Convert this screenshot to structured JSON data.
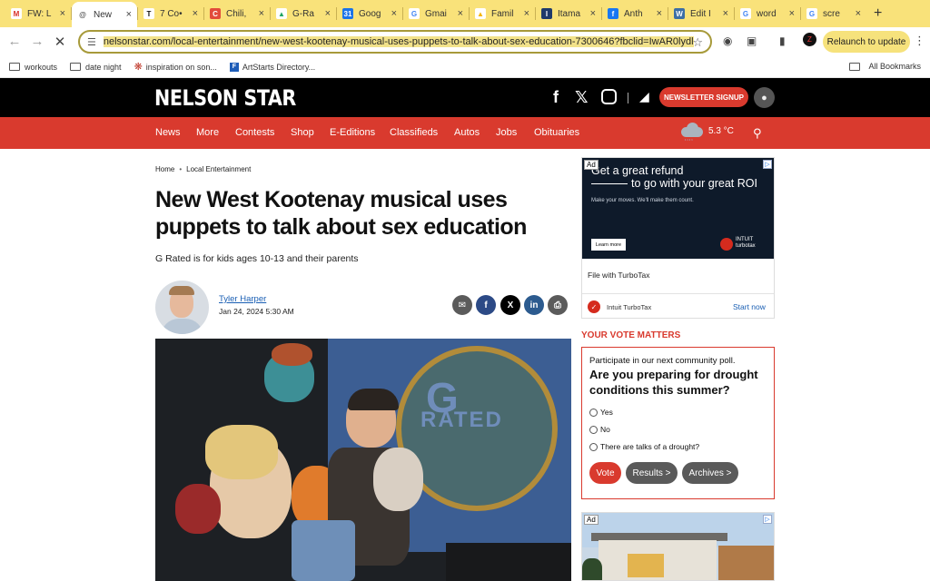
{
  "browser": {
    "tabs": [
      {
        "title": "FW: L",
        "fav_color": "#ffffff",
        "fav_text": "M",
        "fav_text_color": "#d93025"
      },
      {
        "title": "New",
        "fav_color": "#ffffff",
        "fav_text": "@",
        "fav_text_color": "#555555",
        "active": true
      },
      {
        "title": "7 Co•",
        "fav_color": "#ffffff",
        "fav_text": "T",
        "fav_text_color": "#111111"
      },
      {
        "title": "Chili,",
        "fav_color": "#e24b3b",
        "fav_text": "C",
        "fav_text_color": "#ffffff"
      },
      {
        "title": "G-Ra",
        "fav_color": "#ffffff",
        "fav_text": "▲",
        "fav_text_color": "#1fa463"
      },
      {
        "title": "Goog",
        "fav_color": "#1a73e8",
        "fav_text": "31",
        "fav_text_color": "#ffffff"
      },
      {
        "title": "Gmai",
        "fav_color": "#ffffff",
        "fav_text": "G",
        "fav_text_color": "#4285f4"
      },
      {
        "title": "Famil",
        "fav_color": "#ffffff",
        "fav_text": "▲",
        "fav_text_color": "#f4b400"
      },
      {
        "title": "Itama",
        "fav_color": "#1f3a6b",
        "fav_text": "I",
        "fav_text_color": "#ffffff"
      },
      {
        "title": "Anth",
        "fav_color": "#1877f2",
        "fav_text": "f",
        "fav_text_color": "#ffffff"
      },
      {
        "title": "Edit I",
        "fav_color": "#3c6ea5",
        "fav_text": "W",
        "fav_text_color": "#ffffff"
      },
      {
        "title": "word",
        "fav_color": "#ffffff",
        "fav_text": "G",
        "fav_text_color": "#4285f4"
      },
      {
        "title": "scre",
        "fav_color": "#ffffff",
        "fav_text": "G",
        "fav_text_color": "#4285f4"
      }
    ],
    "new_tab": "+",
    "close_glyph": "×",
    "url": "nelsonstar.com/local-entertainment/new-west-kootenay-musical-uses-puppets-to-talk-about-sex-education-7300646?fbclid=IwAR0lydl",
    "relaunch_label": "Relaunch to update",
    "bookmarks": [
      {
        "label": "workouts",
        "icon": "folder-icon"
      },
      {
        "label": "date night",
        "icon": "folder-icon"
      },
      {
        "label": "inspiration on son...",
        "icon": "maple-leaf-icon"
      },
      {
        "label": "ArtStarts Directory...",
        "icon": "artstarts-icon"
      }
    ],
    "all_bookmarks": "All Bookmarks"
  },
  "site": {
    "logo": "NELSON STAR",
    "newsletter_label": "NEWSLETTER SIGNUP",
    "nav": [
      "News",
      "More",
      "Contests",
      "Shop",
      "E-Editions",
      "Classifieds",
      "Autos",
      "Jobs",
      "Obituaries"
    ],
    "temperature": "5.3 °C",
    "accent": "#d93a2e"
  },
  "article": {
    "breadcrumb": [
      "Home",
      "Local Entertainment"
    ],
    "headline": "New West Kootenay musical uses puppets to talk about sex education",
    "dek": "G Rated is for kids ages 10-13 and their parents",
    "author": "Tyler Harper",
    "date": "Jan 24, 2024 5:30 AM",
    "photo_text": [
      "G",
      "RATED"
    ]
  },
  "ad1": {
    "tag": "Ad",
    "line1": "Get a great refund",
    "line2": "to go with your great ROI",
    "line3": "Make your moves. We'll make them count.",
    "learn": "Learn more",
    "badge_text": "INTUIT turbotax",
    "caption": "File with TurboTax",
    "brand": "Intuit TurboTax",
    "cta": "Start now"
  },
  "poll": {
    "heading": "YOUR VOTE MATTERS",
    "intro": "Participate in our next community poll.",
    "question": "Are you preparing for drought conditions this summer?",
    "options": [
      "Yes",
      "No",
      "There are talks of a drought?"
    ],
    "buttons": [
      "Vote",
      "Results >",
      "Archives >"
    ]
  },
  "ad2": {
    "tag": "Ad"
  }
}
